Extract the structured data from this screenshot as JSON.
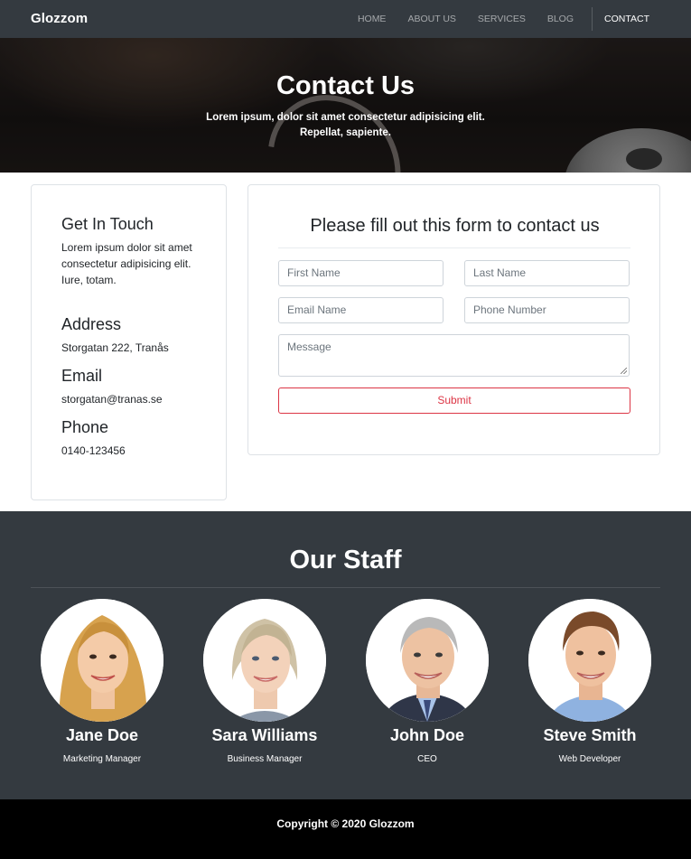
{
  "navbar": {
    "brand": "Glozzom",
    "links": [
      {
        "label": "HOME",
        "active": false
      },
      {
        "label": "ABOUT US",
        "active": false
      },
      {
        "label": "SERVICES",
        "active": false
      },
      {
        "label": "BLOG",
        "active": false
      },
      {
        "label": "CONTACT",
        "active": true
      }
    ]
  },
  "hero": {
    "title": "Contact Us",
    "subtitle": "Lorem ipsum, dolor sit amet consectetur adipisicing elit. Repellat, sapiente."
  },
  "info": {
    "get_in_touch_heading": "Get In Touch",
    "get_in_touch_text": "Lorem ipsum dolor sit amet consectetur adipisicing elit. Iure, totam.",
    "address_heading": "Address",
    "address_text": "Storgatan 222, Tranås",
    "email_heading": "Email",
    "email_text": "storgatan@tranas.se",
    "phone_heading": "Phone",
    "phone_text": "0140-123456"
  },
  "form": {
    "title": "Please fill out this form to contact us",
    "first_name_placeholder": "First Name",
    "last_name_placeholder": "Last Name",
    "email_placeholder": "Email Name",
    "phone_placeholder": "Phone Number",
    "message_placeholder": "Message",
    "submit_label": "Submit"
  },
  "staff": {
    "heading": "Our Staff",
    "members": [
      {
        "name": "Jane Doe",
        "role": "Marketing Manager"
      },
      {
        "name": "Sara Williams",
        "role": "Business Manager"
      },
      {
        "name": "John Doe",
        "role": "CEO"
      },
      {
        "name": "Steve Smith",
        "role": "Web Developer"
      }
    ]
  },
  "footer": {
    "copyright": "Copyright © 2020 Glozzom"
  },
  "colors": {
    "navbar_bg": "#343a40",
    "staff_bg": "#343a40",
    "footer_bg": "#000000",
    "submit_accent": "#dc3545"
  }
}
